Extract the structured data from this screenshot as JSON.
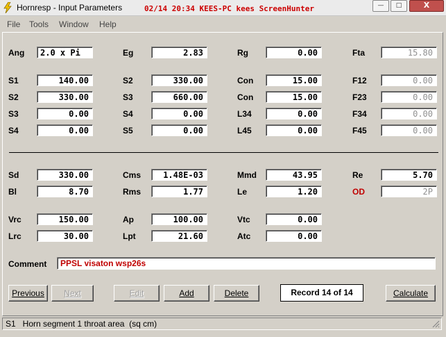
{
  "window": {
    "title": "Hornresp - Input Parameters",
    "overlay_text": "02/14 20:34 KEES-PC kees ScreenHunter",
    "minimize_glyph": "—",
    "maximize_glyph": "□",
    "close_glyph": "X"
  },
  "menu": [
    "File",
    "Tools",
    "Window",
    "Help"
  ],
  "params": {
    "Ang": {
      "label": "Ang",
      "value": "2.0 x Pi"
    },
    "Eg": {
      "label": "Eg",
      "value": "2.83"
    },
    "Rg": {
      "label": "Rg",
      "value": "0.00"
    },
    "Fta": {
      "label": "Fta",
      "value": "15.80"
    },
    "S1": {
      "label": "S1",
      "value": "140.00"
    },
    "S2a": {
      "label": "S2",
      "value": "330.00"
    },
    "Con1": {
      "label": "Con",
      "value": "15.00"
    },
    "F12": {
      "label": "F12",
      "value": "0.00"
    },
    "S2": {
      "label": "S2",
      "value": "330.00"
    },
    "S3a": {
      "label": "S3",
      "value": "660.00"
    },
    "Con2": {
      "label": "Con",
      "value": "15.00"
    },
    "F23": {
      "label": "F23",
      "value": "0.00"
    },
    "S3": {
      "label": "S3",
      "value": "0.00"
    },
    "S4a": {
      "label": "S4",
      "value": "0.00"
    },
    "L34": {
      "label": "L34",
      "value": "0.00"
    },
    "F34": {
      "label": "F34",
      "value": "0.00"
    },
    "S4": {
      "label": "S4",
      "value": "0.00"
    },
    "S5": {
      "label": "S5",
      "value": "0.00"
    },
    "L45": {
      "label": "L45",
      "value": "0.00"
    },
    "F45": {
      "label": "F45",
      "value": "0.00"
    },
    "Sd": {
      "label": "Sd",
      "value": "330.00"
    },
    "Cms": {
      "label": "Cms",
      "value": "1.48E-03"
    },
    "Mmd": {
      "label": "Mmd",
      "value": "43.95"
    },
    "Re": {
      "label": "Re",
      "value": "5.70"
    },
    "Bl": {
      "label": "Bl",
      "value": "8.70"
    },
    "Rms": {
      "label": "Rms",
      "value": "1.77"
    },
    "Le": {
      "label": "Le",
      "value": "1.20"
    },
    "OD": {
      "label": "OD",
      "value": "2P"
    },
    "Vrc": {
      "label": "Vrc",
      "value": "150.00"
    },
    "Ap": {
      "label": "Ap",
      "value": "100.00"
    },
    "Vtc": {
      "label": "Vtc",
      "value": "0.00"
    },
    "Lrc": {
      "label": "Lrc",
      "value": "30.00"
    },
    "Lpt": {
      "label": "Lpt",
      "value": "21.60"
    },
    "Atc": {
      "label": "Atc",
      "value": "0.00"
    }
  },
  "comment": {
    "label": "Comment",
    "value": "PPSL visaton wsp26s"
  },
  "buttons": {
    "previous": "Previous",
    "next": "Next",
    "edit": "Edit",
    "add": "Add",
    "delete": "Delete",
    "calculate": "Calculate"
  },
  "record": "Record 14 of 14",
  "status": "S1   Horn segment 1 throat area  (sq cm)",
  "colors": {
    "accent_red": "#c00000",
    "window_bg": "#d4d0c8"
  }
}
